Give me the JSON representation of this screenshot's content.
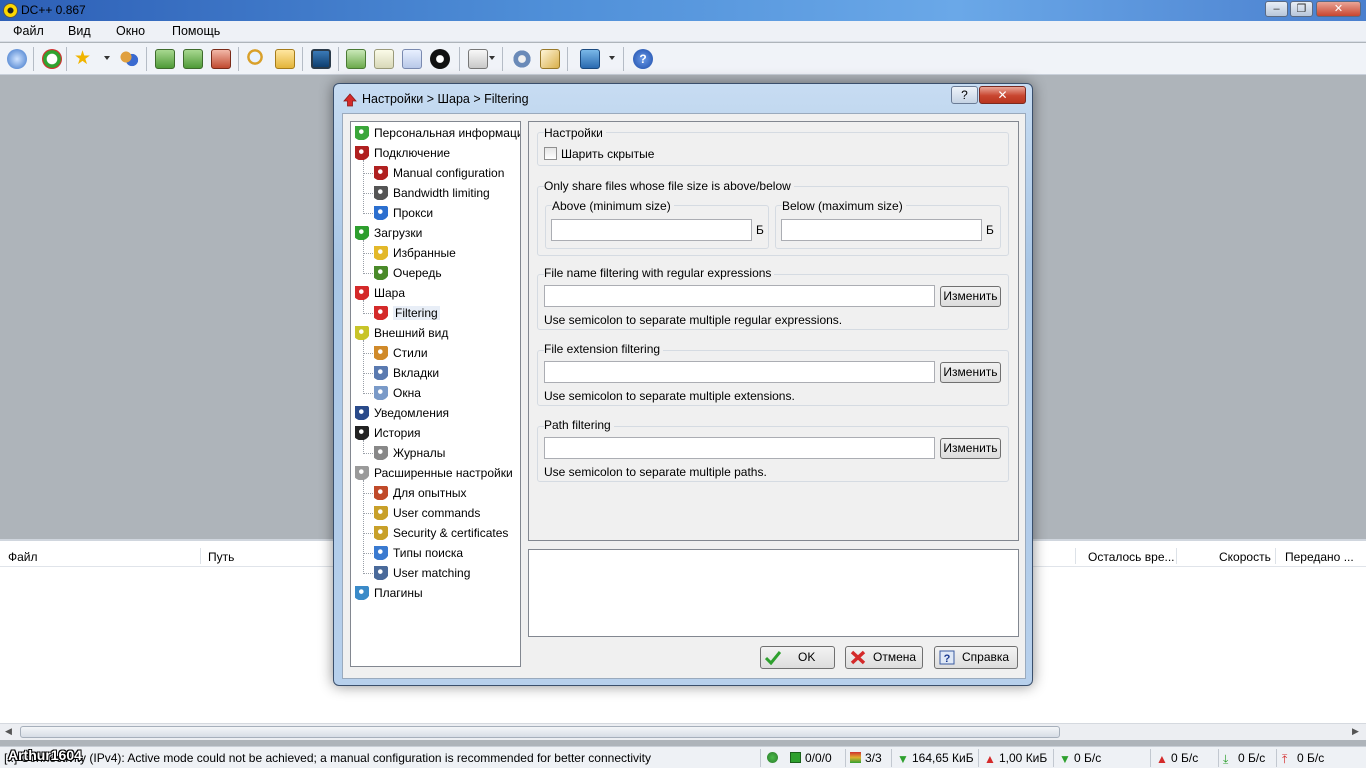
{
  "app": {
    "title": "DC++ 0.867"
  },
  "menu": [
    "Файл",
    "Вид",
    "Окно",
    "Помощь"
  ],
  "toolbar": {
    "icons": [
      "globe-icon",
      "refresh-icon",
      "favorites-star-icon",
      "users-icon",
      "share-list-icon",
      "share-refresh-icon",
      "share-remove-icon",
      "search-icon",
      "search-folder-icon",
      "monitor-icon",
      "upload-folder-icon",
      "download-folder-icon",
      "notepad-icon",
      "clock-icon",
      "dropdown-icon",
      "settings-gear-icon",
      "edit-icon",
      "network-icon",
      "help-icon"
    ]
  },
  "transfers": {
    "columns": [
      "Файл",
      "Путь",
      "Осталось вре...",
      "Скорость",
      "Передано ..."
    ]
  },
  "statusbar": {
    "message": "[..] Connectivity (IPv4): Active mode could not be achieved; a manual configuration is recommended for better connectivity",
    "hubs": "0/0/0",
    "slots": "3/3",
    "downloaded": "164,65 КиБ",
    "uploaded": "1,00 КиБ",
    "down_speed": "0 Б/с",
    "up_speed": "0 Б/с",
    "down_speed2": "0 Б/с",
    "up_speed2": "0 Б/с"
  },
  "watermark": "Arthur1604",
  "dialog": {
    "title": "Настройки > Шара > Filtering",
    "help": "?",
    "close": "✕",
    "tree": [
      {
        "label": "Персональная информация",
        "level": 0,
        "icon": "person-icon",
        "color": "#3aa63a"
      },
      {
        "label": "Подключение",
        "level": 0,
        "icon": "antenna-icon",
        "color": "#b02020"
      },
      {
        "label": "Manual configuration",
        "level": 1,
        "icon": "antenna-icon",
        "color": "#b02020"
      },
      {
        "label": "Bandwidth limiting",
        "level": 1,
        "icon": "gauge-icon",
        "color": "#555555"
      },
      {
        "label": "Прокси",
        "level": 1,
        "icon": "globe-icon",
        "color": "#2c6fcf"
      },
      {
        "label": "Загрузки",
        "level": 0,
        "icon": "down-arrow-icon",
        "color": "#2e9e2e"
      },
      {
        "label": "Избранные",
        "level": 1,
        "icon": "folder-star-icon",
        "color": "#e3b82a"
      },
      {
        "label": "Очередь",
        "level": 1,
        "icon": "queue-icon",
        "color": "#4a8a2a"
      },
      {
        "label": "Шара",
        "level": 0,
        "icon": "up-arrow-icon",
        "color": "#d42a2a"
      },
      {
        "label": "Filtering",
        "level": 1,
        "icon": "up-arrow-icon",
        "color": "#d42a2a",
        "selected": true
      },
      {
        "label": "Внешний вид",
        "level": 0,
        "icon": "eye-icon",
        "color": "#c8c42a"
      },
      {
        "label": "Стили",
        "level": 1,
        "icon": "paint-icon",
        "color": "#d08a2a"
      },
      {
        "label": "Вкладки",
        "level": 1,
        "icon": "tabs-icon",
        "color": "#5a7ab0"
      },
      {
        "label": "Окна",
        "level": 1,
        "icon": "window-icon",
        "color": "#7a9ac8"
      },
      {
        "label": "Уведомления",
        "level": 0,
        "icon": "bell-icon",
        "color": "#2a4a8a"
      },
      {
        "label": "История",
        "level": 0,
        "icon": "clock-icon",
        "color": "#222222"
      },
      {
        "label": "Журналы",
        "level": 1,
        "icon": "log-icon",
        "color": "#888888"
      },
      {
        "label": "Расширенные настройки",
        "level": 0,
        "icon": "gear-icon",
        "color": "#9a9a9a"
      },
      {
        "label": "Для опытных",
        "level": 1,
        "icon": "tools-icon",
        "color": "#c04a2a"
      },
      {
        "label": "User commands",
        "level": 1,
        "icon": "key-icon",
        "color": "#c8a02a"
      },
      {
        "label": "Security & certificates",
        "level": 1,
        "icon": "lock-icon",
        "color": "#c8a02a"
      },
      {
        "label": "Типы поиска",
        "level": 1,
        "icon": "search-icon",
        "color": "#3a7ad0"
      },
      {
        "label": "User matching",
        "level": 1,
        "icon": "users-icon",
        "color": "#4a6a9a"
      },
      {
        "label": "Плагины",
        "level": 0,
        "icon": "plugin-icon",
        "color": "#3a8ac8"
      }
    ],
    "settings_group": "Настройки",
    "share_hidden_label": "Шарить скрытые",
    "share_hidden_checked": false,
    "size_group": "Only share files whose file size is above/below",
    "above_label": "Above (minimum size)",
    "above_value": "",
    "above_unit": "Б",
    "below_label": "Below (maximum size)",
    "below_value": "",
    "below_unit": "Б",
    "regex_group": "File name filtering with regular expressions",
    "regex_value": "",
    "regex_button": "Изменить",
    "regex_hint": "Use semicolon to separate multiple regular expressions.",
    "ext_group": "File extension filtering",
    "ext_value": "",
    "ext_button": "Изменить",
    "ext_hint": "Use semicolon to separate multiple extensions.",
    "path_group": "Path filtering",
    "path_value": "",
    "path_button": "Изменить",
    "path_hint": "Use semicolon to separate multiple paths.",
    "ok": "OK",
    "cancel": "Отмена",
    "help_button": "Справка"
  }
}
